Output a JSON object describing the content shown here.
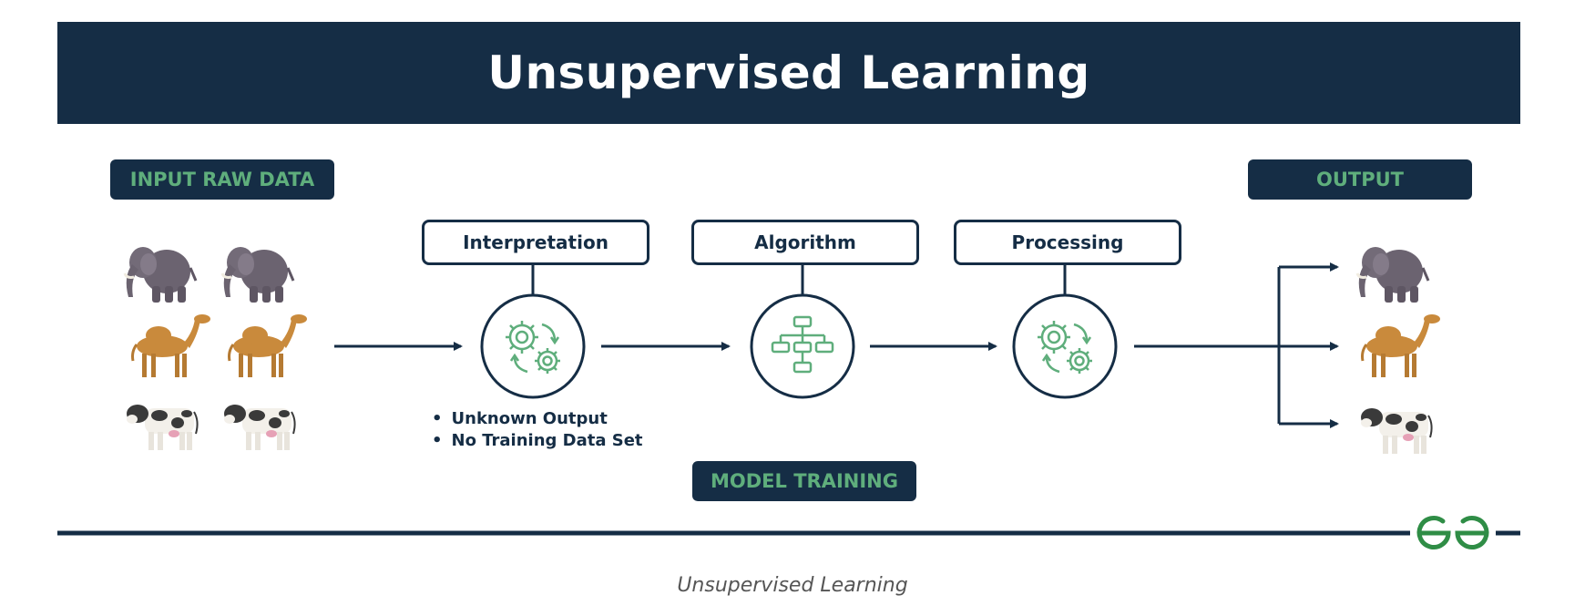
{
  "title": "Unsupervised Learning",
  "input_label": "INPUT RAW DATA",
  "output_label": "OUTPUT",
  "steps": [
    "Interpretation",
    "Algorithm",
    "Processing"
  ],
  "notes": [
    "Unknown Output",
    "No Training Data Set"
  ],
  "model_training_label": "MODEL TRAINING",
  "caption": "Unsupervised Learning",
  "icons": {
    "inputs": [
      "elephant-icon",
      "elephant-icon",
      "camel-icon",
      "camel-icon",
      "cow-icon",
      "cow-icon"
    ],
    "outputs": [
      "elephant-icon",
      "camel-icon",
      "cow-icon"
    ],
    "step_icons": [
      "gears-icon",
      "flowchart-icon",
      "gears-icon"
    ],
    "brand": "geeksforgeeks-logo"
  },
  "colors": {
    "navy": "#152d45",
    "green": "#5fae7c",
    "logo_green": "#2f8d46"
  }
}
